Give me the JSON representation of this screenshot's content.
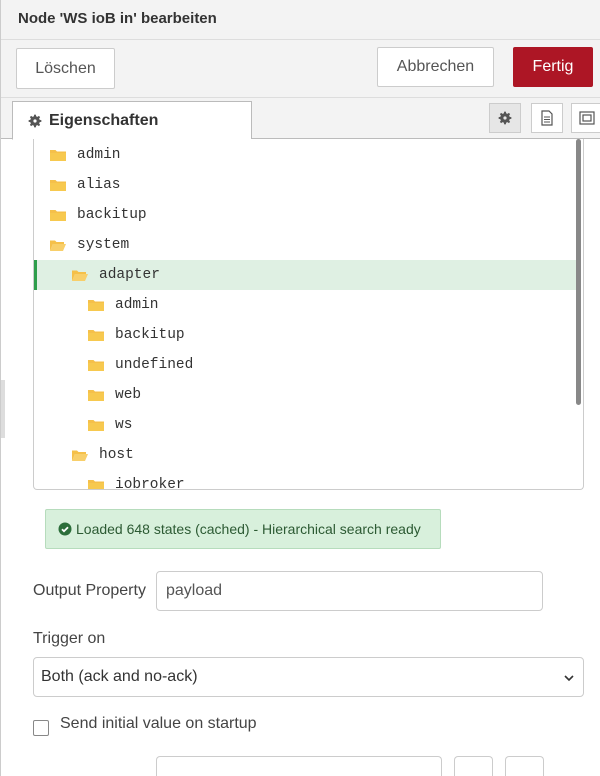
{
  "dialog": {
    "title": "Node 'WS ioB in' bearbeiten"
  },
  "buttons": {
    "delete": "Löschen",
    "cancel": "Abbrechen",
    "done": "Fertig"
  },
  "tabs": {
    "properties": "Eigenschaften"
  },
  "tree": {
    "items": [
      {
        "label": "admin",
        "level": 0,
        "selected": false,
        "open": false
      },
      {
        "label": "alias",
        "level": 0,
        "selected": false,
        "open": false
      },
      {
        "label": "backitup",
        "level": 0,
        "selected": false,
        "open": false
      },
      {
        "label": "system",
        "level": 0,
        "selected": false,
        "open": true
      },
      {
        "label": "adapter",
        "level": 1,
        "selected": true,
        "open": true
      },
      {
        "label": "admin",
        "level": 2,
        "selected": false,
        "open": false
      },
      {
        "label": "backitup",
        "level": 2,
        "selected": false,
        "open": false
      },
      {
        "label": "undefined",
        "level": 2,
        "selected": false,
        "open": false
      },
      {
        "label": "web",
        "level": 2,
        "selected": false,
        "open": false
      },
      {
        "label": "ws",
        "level": 2,
        "selected": false,
        "open": false
      },
      {
        "label": "host",
        "level": 1,
        "selected": false,
        "open": true
      },
      {
        "label": "iobroker",
        "level": 2,
        "selected": false,
        "open": false
      }
    ]
  },
  "status": {
    "text": "Loaded 648 states (cached) - Hierarchical search ready"
  },
  "form": {
    "output_property_label": "Output Property",
    "output_property_value": "payload",
    "trigger_label": "Trigger on",
    "trigger_value": "Both (ack and no-ack)",
    "initial_value_label": "Send initial value on startup"
  },
  "colors": {
    "accent": "#ad1625",
    "folder": "#f5c04a",
    "selected_bg": "#dff0e3",
    "selected_border": "#2e9e4b",
    "status_bg": "#d8f0dc"
  }
}
